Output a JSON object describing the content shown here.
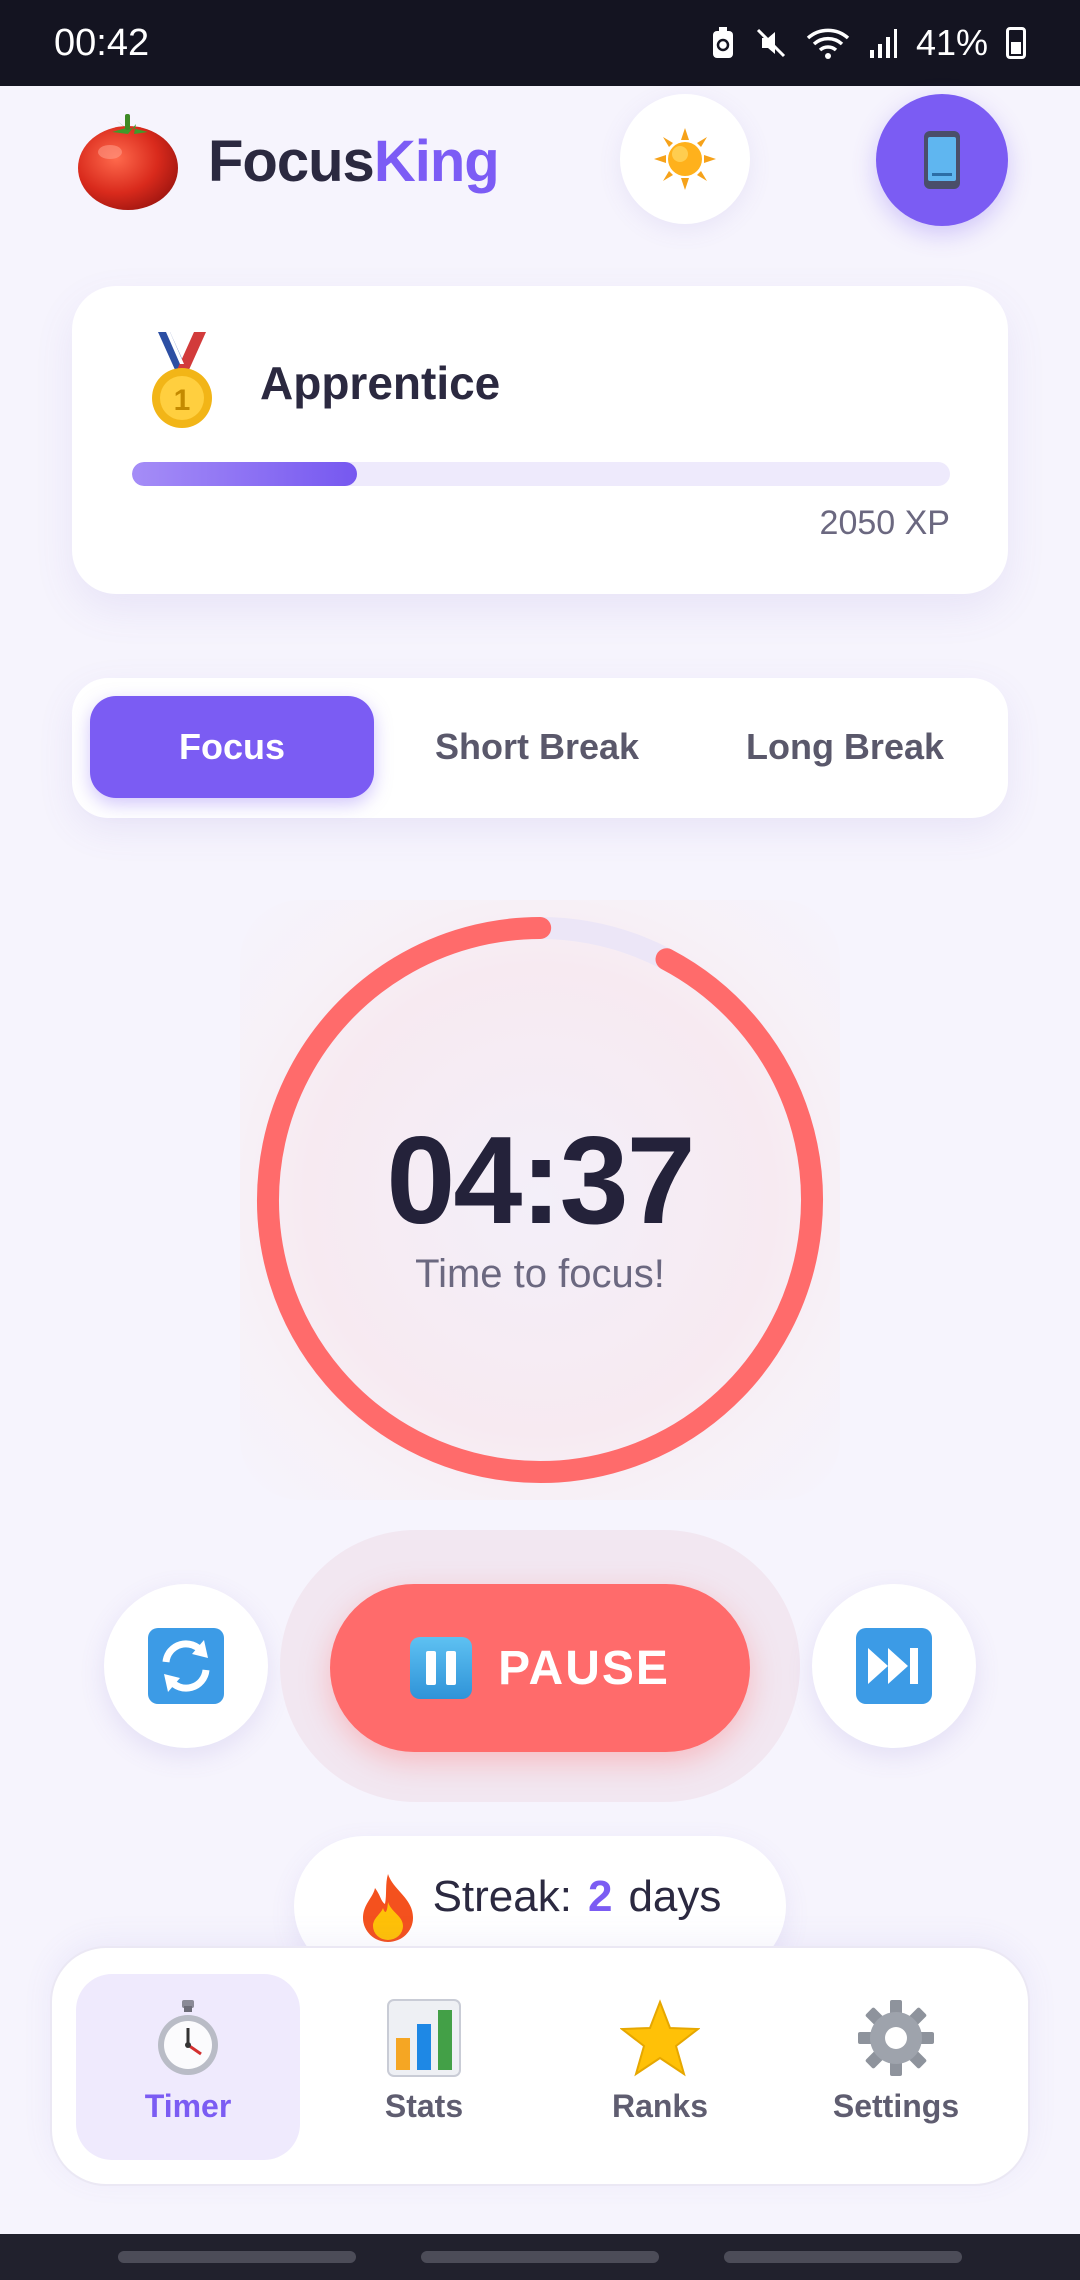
{
  "status_bar": {
    "time": "00:42",
    "battery": "41%"
  },
  "header": {
    "brand_part1": "Focus",
    "brand_part2": "King"
  },
  "rank": {
    "title": "Apprentice",
    "xp_text": "2050 XP",
    "xp_progress": 0.275
  },
  "tabs": [
    {
      "label": "Focus",
      "active": true
    },
    {
      "label": "Short Break",
      "active": false
    },
    {
      "label": "Long Break",
      "active": false
    }
  ],
  "timer": {
    "time": "04:37",
    "label": "Time to focus!",
    "progress_remaining": 0.923
  },
  "controls": {
    "pause_label": "PAUSE"
  },
  "streak": {
    "prefix": "Streak:",
    "count": "2",
    "suffix": "days"
  },
  "nav": [
    {
      "label": "Timer",
      "icon": "stopwatch-icon",
      "active": true
    },
    {
      "label": "Stats",
      "icon": "bar-chart-icon",
      "active": false
    },
    {
      "label": "Ranks",
      "icon": "star-icon",
      "active": false
    },
    {
      "label": "Settings",
      "icon": "gear-icon",
      "active": false
    }
  ],
  "colors": {
    "accent": "#7b5cf3",
    "timer_ring": "#ff6b6b",
    "background": "#f6f4fd"
  }
}
